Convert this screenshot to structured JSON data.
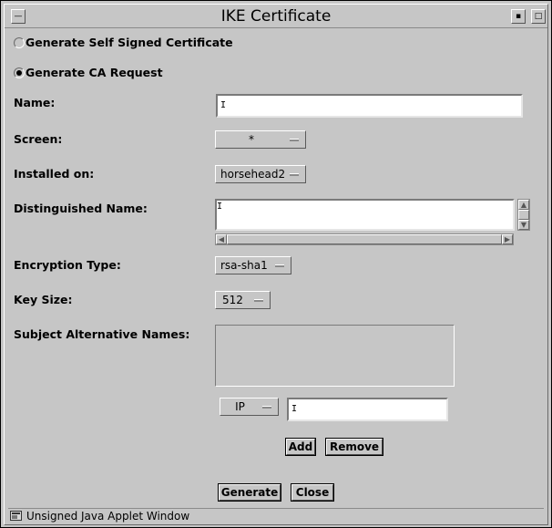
{
  "window": {
    "title": "IKE Certificate"
  },
  "options": {
    "self_signed_label": "Generate Self Signed Certificate",
    "ca_request_label": "Generate CA Request",
    "selected": "ca_request"
  },
  "form": {
    "name_label": "Name:",
    "name_value": "",
    "screen_label": "Screen:",
    "screen_value": "*",
    "installed_label": "Installed on:",
    "installed_value": "horsehead2",
    "dn_label": "Distinguished Name:",
    "dn_value": "",
    "encryption_label": "Encryption Type:",
    "encryption_value": "rsa-sha1",
    "keysize_label": "Key Size:",
    "keysize_value": "512",
    "san_label": "Subject Alternative Names:",
    "san_items": [],
    "san_type_value": "IP",
    "san_input_value": ""
  },
  "buttons": {
    "add": "Add",
    "remove": "Remove",
    "generate": "Generate",
    "close": "Close"
  },
  "status": {
    "text": "Unsigned Java Applet Window"
  },
  "icons": {
    "window_menu": "window-menu-icon",
    "minimize": "minimize-icon",
    "maximize": "maximize-icon",
    "applet": "java-applet-icon"
  }
}
